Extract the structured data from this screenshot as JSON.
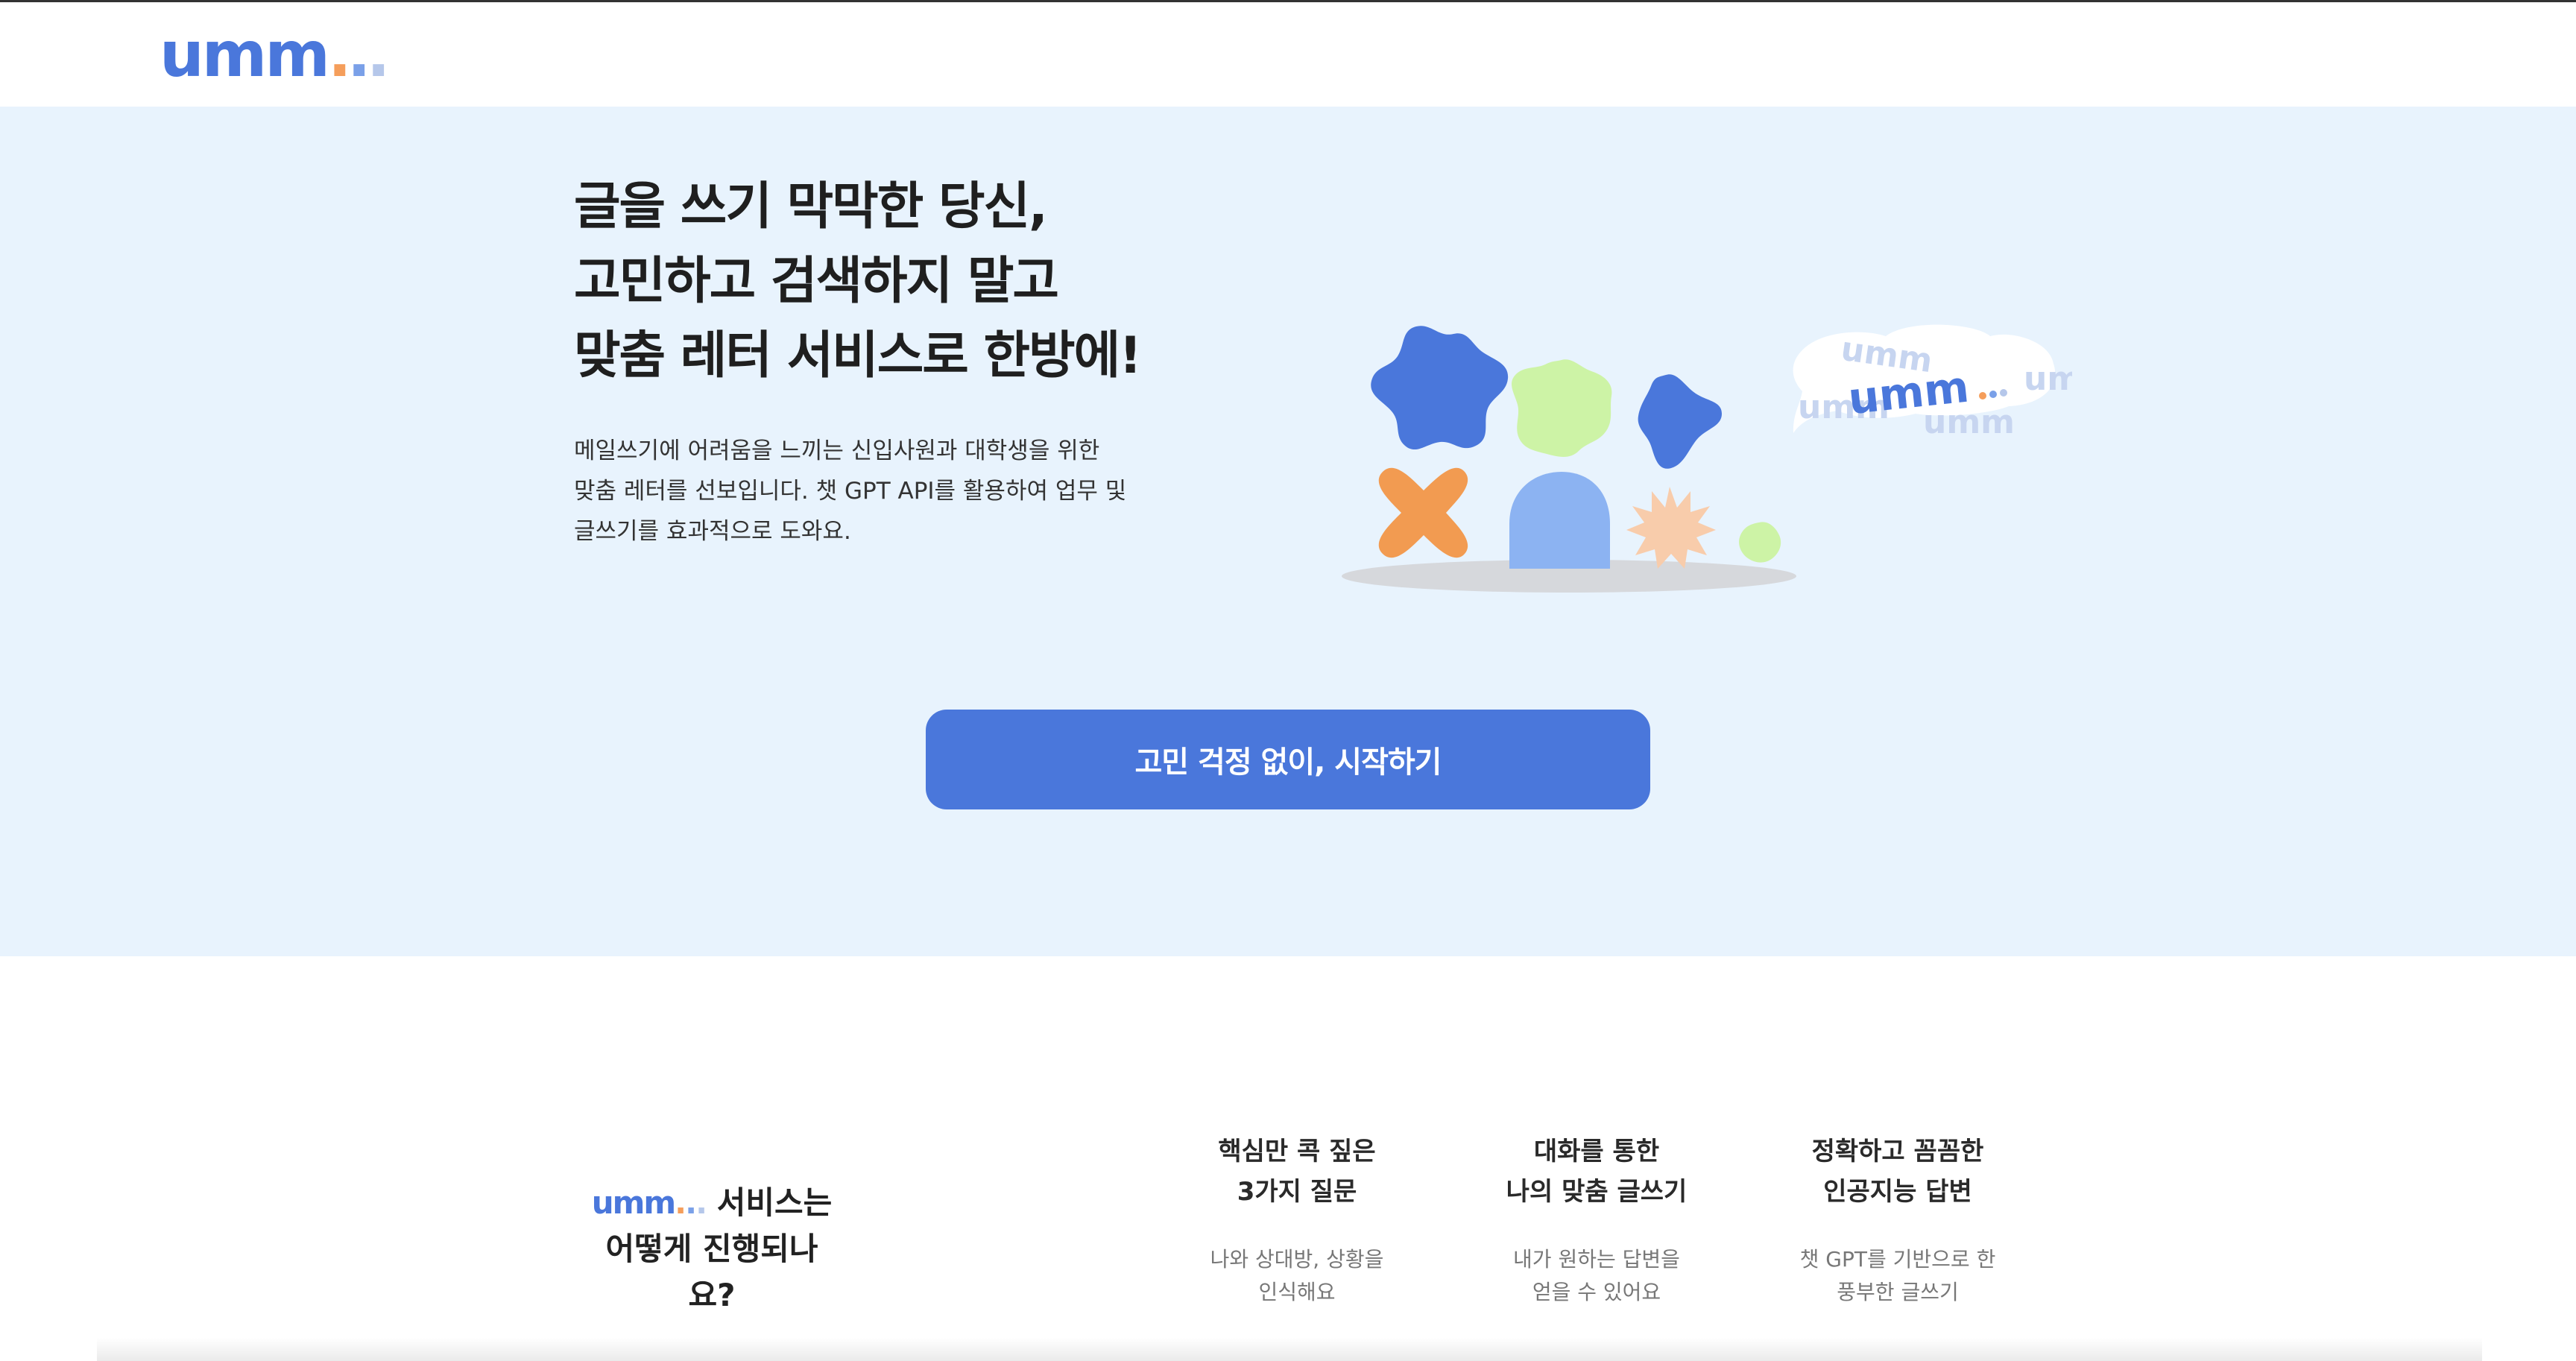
{
  "header": {
    "logo_text": "umm"
  },
  "hero": {
    "title_lines": [
      "글을 쓰기 막막한 당신,",
      "고민하고 검색하지 말고",
      "맞춤 레터 서비스로 한방에!"
    ],
    "description_lines": [
      "메일쓰기에 어려움을 느끼는 신입사원과 대학생을 위한",
      "맞춤 레터를 선보입니다. 챗 GPT API를 활용하여 업무 및",
      "글쓰기를 효과적으로 도와요."
    ],
    "cta_label": "고민 걱정 없이, 시작하기",
    "illustration_logo": "umm",
    "illustration_echo_text": "umm"
  },
  "how": {
    "title_logo": "umm",
    "title_suffix": "서비스는",
    "title_line2": "어떻게 진행되나",
    "title_line3": "요?",
    "features": [
      {
        "title_1": "핵심만 콕 짚은",
        "title_2": "3가지 질문",
        "desc_1": "나와 상대방, 상황을",
        "desc_2": "인식해요"
      },
      {
        "title_1": "대화를 통한",
        "title_2": "나의 맞춤 글쓰기",
        "desc_1": "내가 원하는 답변을",
        "desc_2": "얻을 수 있어요"
      },
      {
        "title_1": "정확하고 꼼꼼한",
        "title_2": "인공지능 답변",
        "desc_1": "챗 GPT를 기반으로 한",
        "desc_2": "풍부한 글쓰기"
      }
    ]
  },
  "colors": {
    "brand": "#4a77db",
    "hero_bg": "#e8f3fd",
    "accent_orange": "#f59e5b",
    "accent_green": "#cdf3a6"
  }
}
